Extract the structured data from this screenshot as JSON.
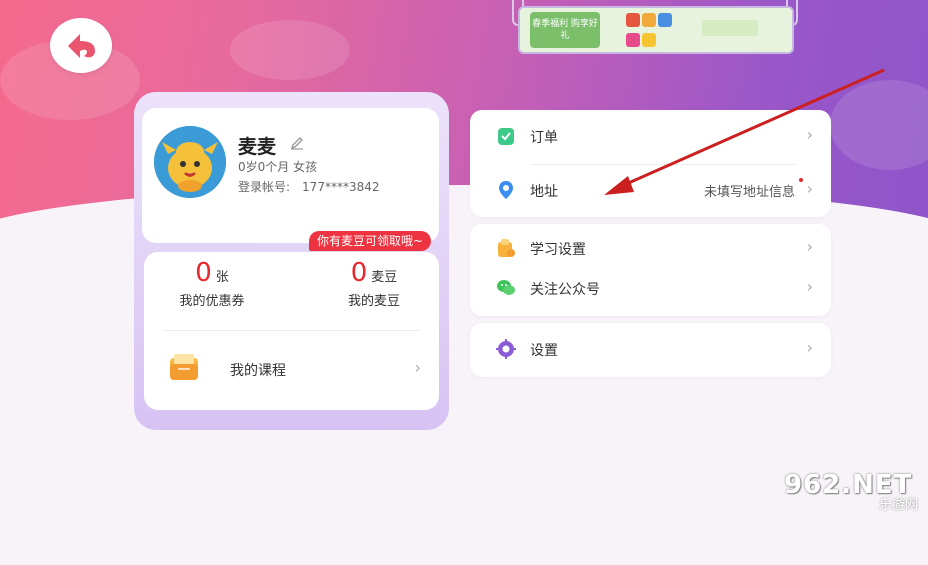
{
  "banner": {
    "tag": "春季福利 购享好礼"
  },
  "profile": {
    "name": "麦麦",
    "age_gender": "0岁0个月  女孩",
    "account_label": "登录帐号:",
    "account_value": "177****3842"
  },
  "notice": "你有麦豆可领取哦~",
  "stats": {
    "coupons": {
      "count": "0",
      "unit": "张",
      "label": "我的优惠券"
    },
    "beans": {
      "count": "0",
      "unit": "麦豆",
      "label": "我的麦豆"
    }
  },
  "course": {
    "label": "我的课程"
  },
  "menu": {
    "order": {
      "label": "订单"
    },
    "address": {
      "label": "地址",
      "value": "未填写地址信息"
    },
    "study": {
      "label": "学习设置"
    },
    "follow": {
      "label": "关注公众号"
    },
    "settings": {
      "label": "设置"
    }
  },
  "chevron": "›",
  "watermark": {
    "logo": "962.NET",
    "sub": "乐游网"
  },
  "colors": {
    "accent_red": "#e8262d",
    "annotation_arrow": "#cc1f1f"
  }
}
